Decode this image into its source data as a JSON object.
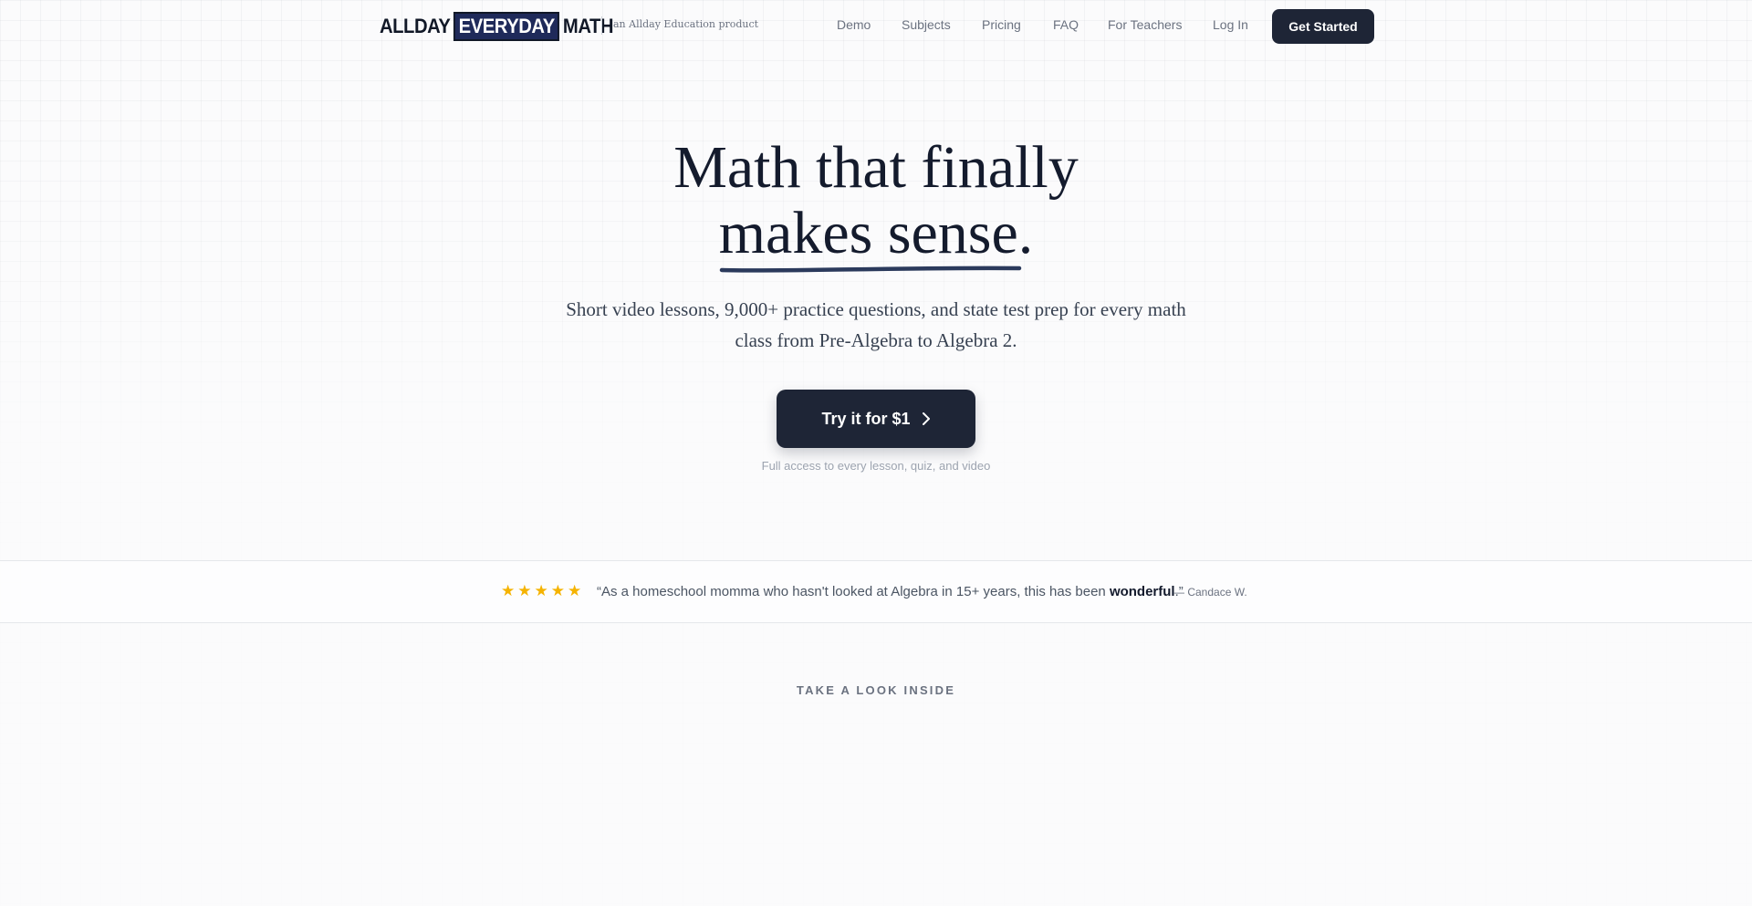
{
  "brand": {
    "logo_left": "ALLDAY",
    "logo_highlight": "EVERYDAY",
    "logo_right": "MATH",
    "tagline": "an Allday Education product"
  },
  "nav": {
    "links": [
      "Demo",
      "Subjects",
      "Pricing",
      "FAQ",
      "For Teachers",
      "Log In"
    ],
    "cta_label": "Get Started"
  },
  "hero": {
    "title_line1": "Math that finally",
    "title_line2": "makes sense.",
    "subtitle": "Short video lessons, 9,000+ practice questions, and state test prep for every math class from Pre-Algebra to Algebra 2.",
    "cta_label": "Try it for $1",
    "cta_note": "Full access to every lesson, quiz, and video"
  },
  "testimonial": {
    "rating": 5,
    "quote_before": "“As a homeschool momma who hasn't looked at Algebra in 15+ years, this has been ",
    "quote_emphasis": "wonderful",
    "quote_after": ".”",
    "author": "— Candace W."
  },
  "section": {
    "label": "TAKE A LOOK INSIDE"
  },
  "colors": {
    "primary_dark": "#1e2536",
    "logo_highlight_bg": "#1f2a5a",
    "star": "#f5b301",
    "underline": "#2b3a5c"
  }
}
